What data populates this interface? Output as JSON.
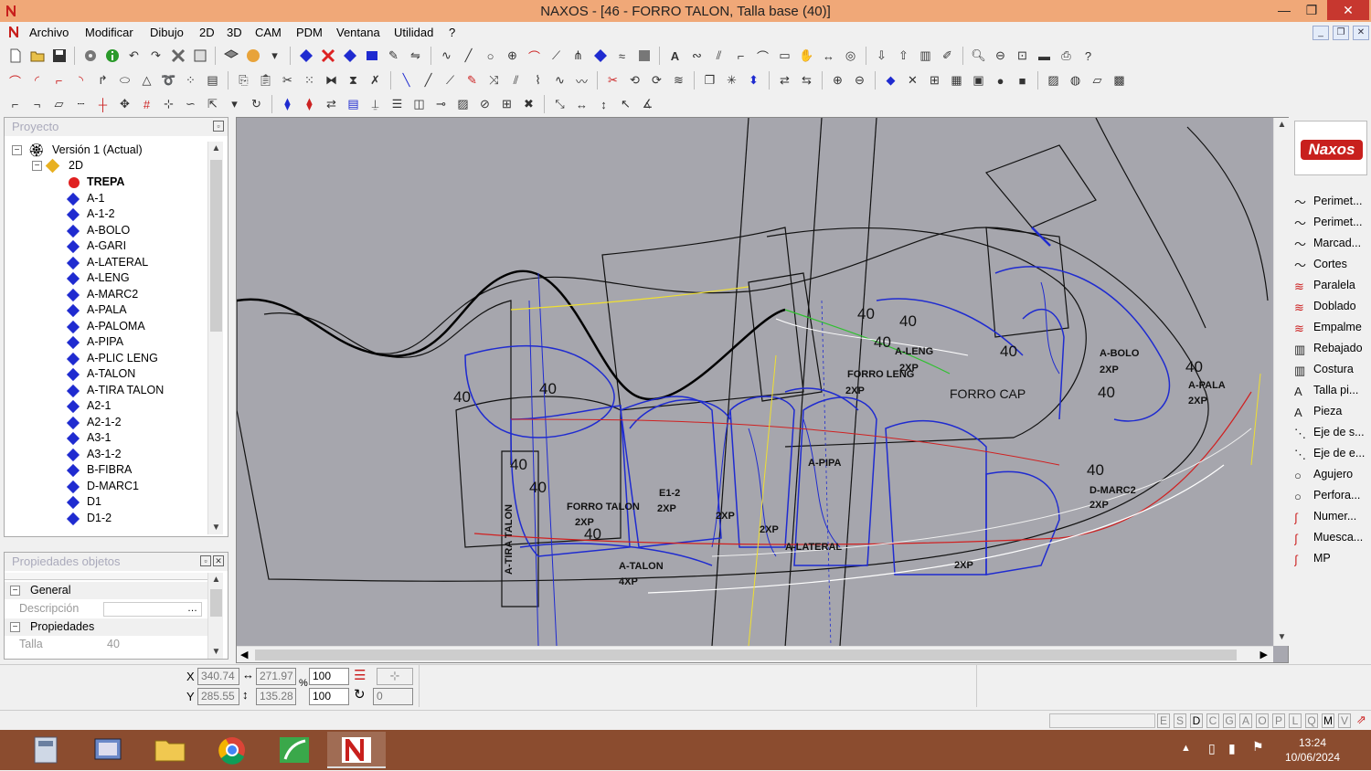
{
  "window": {
    "title": "NAXOS - [46 - FORRO TALON, Talla base (40)]"
  },
  "menu": [
    "Archivo",
    "Modificar",
    "Dibujo",
    "2D",
    "3D",
    "CAM",
    "PDM",
    "Ventana",
    "Utilidad",
    "?"
  ],
  "project_panel": {
    "title": "Proyecto",
    "version": "Versión 1 (Actual)",
    "folder": "2D",
    "items": [
      "TREPA",
      "A-1",
      "A-1-2",
      "A-BOLO",
      "A-GARI",
      "A-LATERAL",
      "A-LENG",
      "A-MARC2",
      "A-PALA",
      "A-PALOMA",
      "A-PIPA",
      "A-PLIC LENG",
      "A-TALON",
      "A-TIRA TALON",
      "A2-1",
      "A2-1-2",
      "A3-1",
      "A3-1-2",
      "B-FIBRA",
      "D-MARC1",
      "D1",
      "D1-2"
    ]
  },
  "props_panel": {
    "title": "Propiedades objetos",
    "group_general": "General",
    "descripcion_label": "Descripción",
    "group_propiedades": "Propiedades",
    "talla_label": "Talla",
    "talla_value": "40"
  },
  "canvas": {
    "labels": [
      "40",
      "40",
      "40",
      "40",
      "40",
      "40",
      "40",
      "40",
      "40",
      "40",
      "40",
      "40",
      "A-LENG",
      "2XP",
      "FORRO LENG",
      "2XP",
      "FORRO CAP",
      "A-BOLO",
      "2XP",
      "A-PALA",
      "2XP",
      "FORRO TALON",
      "2XP",
      "E1-2",
      "2XP",
      "A-TIRA TALON",
      "A-TALON",
      "4XP",
      "A-LATERAL",
      "D-MARC2",
      "2XP",
      "2XP",
      "2XP",
      "A-PIPA",
      "2XP"
    ]
  },
  "palette": {
    "logo": "Naxos",
    "tools": [
      "Perimet...",
      "Perimet...",
      "Marcad...",
      "Cortes",
      "Paralela",
      "Doblado",
      "Empalme",
      "Rebajado",
      "Costura",
      "Talla pi...",
      "Pieza",
      "Eje de s...",
      "Eje de e...",
      "Agujero",
      "Perfora...",
      "Numer...",
      "Muesca...",
      "MP"
    ]
  },
  "coords": {
    "x_label": "X",
    "y_label": "Y",
    "x": "340.74",
    "y": "285.55",
    "w": "271.97",
    "h": "135.28",
    "scale_x": "100",
    "scale_y": "100",
    "rotation": "0"
  },
  "status_letters": [
    "E",
    "S",
    "D",
    "C",
    "G",
    "A",
    "O",
    "P",
    "L",
    "Q",
    "M",
    "V"
  ],
  "taskbar": {
    "time": "13:24",
    "date": "10/06/2024"
  },
  "colors": {
    "titlebar": "#f0a878",
    "taskbar": "#8b4c2f",
    "canvas": "#a6a6ad",
    "piece_blue": "#1f2bd0"
  }
}
